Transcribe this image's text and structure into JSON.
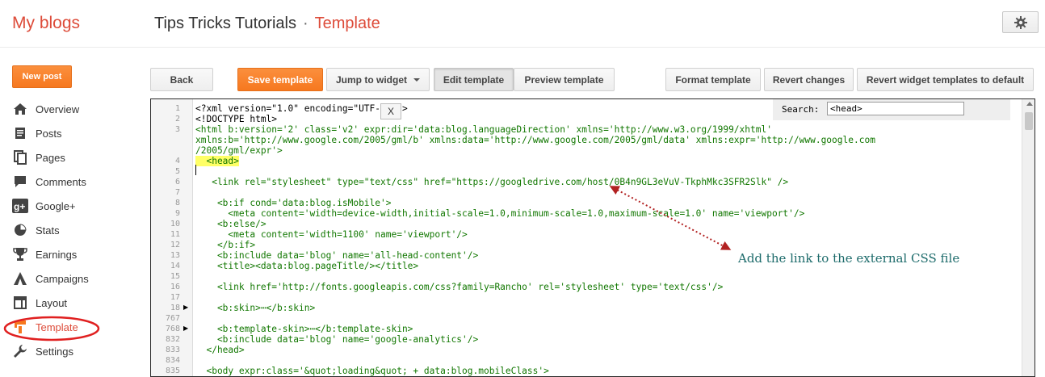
{
  "header": {
    "brand": "My blogs",
    "blog_name": "Tips Tricks Tutorials",
    "separator": "·",
    "page": "Template",
    "settings_icon": "gear-icon"
  },
  "sidebar": {
    "new_post": "New post",
    "items": [
      {
        "label": "Overview",
        "icon": "home-icon"
      },
      {
        "label": "Posts",
        "icon": "posts-icon"
      },
      {
        "label": "Pages",
        "icon": "pages-icon"
      },
      {
        "label": "Comments",
        "icon": "comments-icon"
      },
      {
        "label": "Google+",
        "icon": "google-plus-icon"
      },
      {
        "label": "Stats",
        "icon": "stats-icon"
      },
      {
        "label": "Earnings",
        "icon": "trophy-icon"
      },
      {
        "label": "Campaigns",
        "icon": "campaigns-icon"
      },
      {
        "label": "Layout",
        "icon": "layout-icon"
      },
      {
        "label": "Template",
        "icon": "template-icon",
        "active": true
      },
      {
        "label": "Settings",
        "icon": "wrench-icon"
      }
    ]
  },
  "toolbar": {
    "back": "Back",
    "save": "Save template",
    "jump": "Jump to widget",
    "edit": "Edit template",
    "preview": "Preview template",
    "format": "Format template",
    "revert": "Revert changes",
    "revert_widgets": "Revert widget templates to default"
  },
  "search": {
    "label": "Search:",
    "value": "<head>",
    "close": "X"
  },
  "editor": {
    "line_numbers": [
      "1",
      "2",
      "3",
      "",
      "",
      "4",
      "5",
      "6",
      "7",
      "8",
      "9",
      "10",
      "11",
      "12",
      "13",
      "14",
      "15",
      "16",
      "17",
      "18",
      "767",
      "768",
      "832",
      "833",
      "834",
      "835"
    ],
    "code_lines": [
      "<?xml version=\"1.0\" encoding=\"UTF-8\" ?>",
      "<!DOCTYPE html>",
      "<html b:version='2' class='v2' expr:dir='data:blog.languageDirection' xmlns='http://www.w3.org/1999/xhtml'",
      "xmlns:b='http://www.google.com/2005/gml/b' xmlns:data='http://www.google.com/2005/gml/data' xmlns:expr='http://www.google.com",
      "/2005/gml/expr'>",
      "  <head>",
      "",
      "   <link rel=\"stylesheet\" type=\"text/css\" href=\"https://googledrive.com/host/0B4n9GL3eVuV-TkphMkc3SFR2Slk\" />",
      "",
      "    <b:if cond='data:blog.isMobile'>",
      "      <meta content='width=device-width,initial-scale=1.0,minimum-scale=1.0,maximum-scale=1.0' name='viewport'/>",
      "    <b:else/>",
      "      <meta content='width=1100' name='viewport'/>",
      "    </b:if>",
      "    <b:include data='blog' name='all-head-content'/>",
      "    <title><data:blog.pageTitle/></title>",
      "",
      "    <link href='http://fonts.googleapis.com/css?family=Rancho' rel='stylesheet' type='text/css'/>",
      "",
      "    <b:skin>⋯</b:skin>",
      "",
      "    <b:template-skin>⋯</b:template-skin>",
      "    <b:include data='blog' name='google-analytics'/>",
      "  </head>",
      "",
      "  <body expr:class='&quot;loading&quot; + data:blog.mobileClass'>"
    ]
  },
  "annotation": "Add the link to the external CSS file",
  "colors": {
    "accent_orange": "#f6781f",
    "brand_red": "#dd4b39",
    "annotation_teal": "#1d6b6b",
    "highlight_yellow": "#ffff66",
    "ellipse_red": "#e02020"
  }
}
